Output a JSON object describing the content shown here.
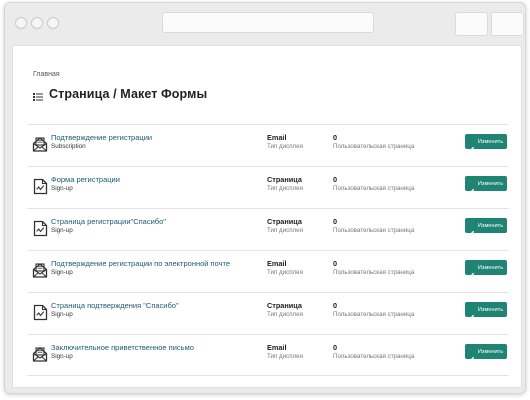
{
  "browser": {
    "window_dots": [
      "close-dot",
      "minimize-dot",
      "maximize-dot"
    ]
  },
  "breadcrumb": "Главная",
  "page_title": "Страница / Макет Формы",
  "edit_label": "Изменить",
  "colors": {
    "link": "#1d5a73",
    "button": "#1f8474"
  },
  "rows": [
    {
      "name": "Подтверждение регистрации",
      "sub": "Subscription",
      "type": "Email",
      "type_label": "Тип дисплея",
      "count": "0",
      "count_label": "Пользовательская страница",
      "icon": "envelope-icon"
    },
    {
      "name": "Форма регистрации",
      "sub": "Sign-up",
      "type": "Страница",
      "type_label": "Тип дисплея",
      "count": "0",
      "count_label": "Пользовательская страница",
      "icon": "page-icon"
    },
    {
      "name": "Страница регистрации\"Спасибо\"",
      "sub": "Sign-up",
      "type": "Страница",
      "type_label": "Тип дисплея",
      "count": "0",
      "count_label": "Пользовательская страница",
      "icon": "page-icon"
    },
    {
      "name": "Подтверждение регистрации по электронной почте",
      "sub": "Sign-up",
      "type": "Email",
      "type_label": "Тип дисплея",
      "count": "0",
      "count_label": "Пользовательская страница",
      "icon": "envelope-icon"
    },
    {
      "name": "Страница подтверждения \"Спасибо\"",
      "sub": "Sign-up",
      "type": "Страница",
      "type_label": "Тип дисплея",
      "count": "0",
      "count_label": "Пользовательская страница",
      "icon": "page-icon"
    },
    {
      "name": "Заключительное приветственное письмо",
      "sub": "Sign-up",
      "type": "Email",
      "type_label": "Тип дисплея",
      "count": "0",
      "count_label": "Пользовательская страница",
      "icon": "envelope-icon"
    }
  ]
}
